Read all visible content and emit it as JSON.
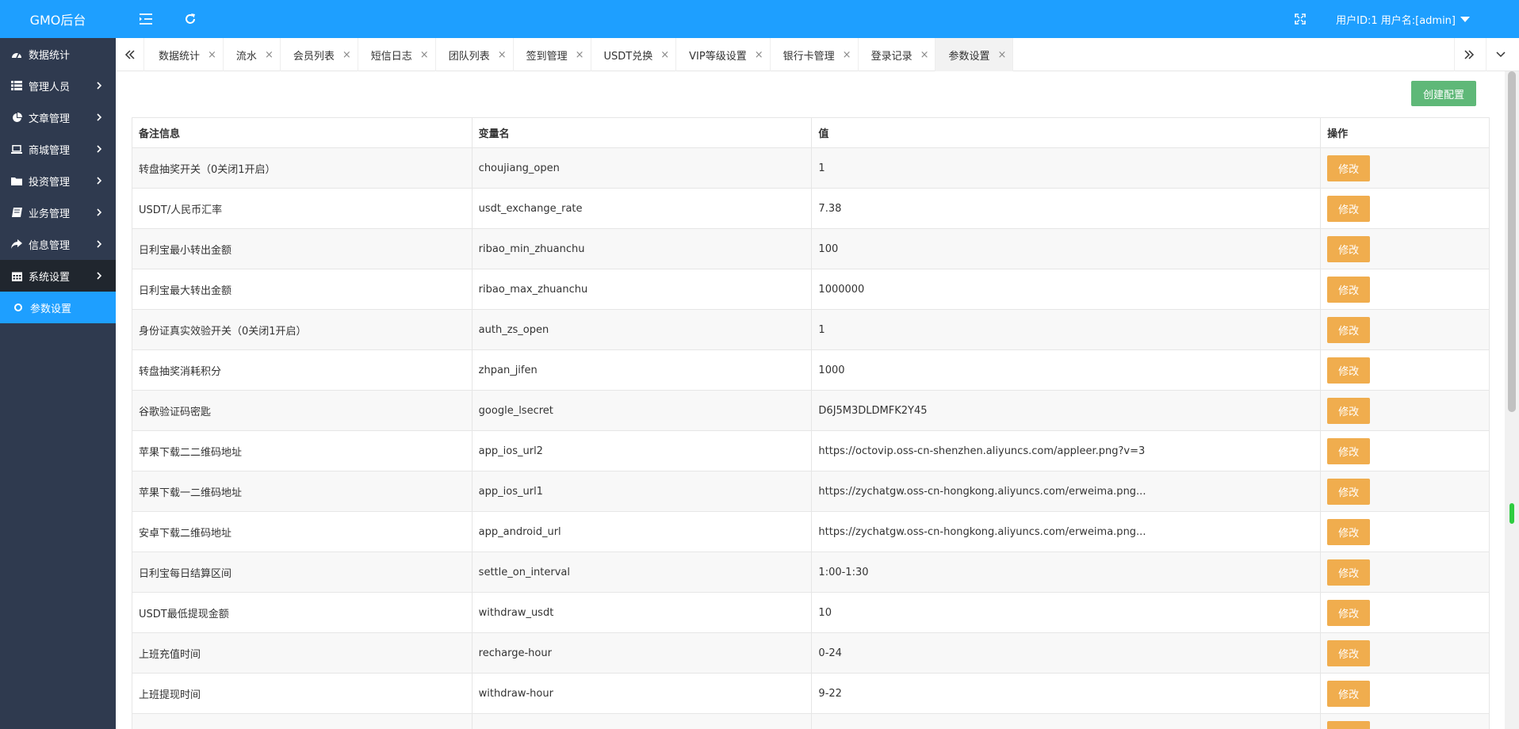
{
  "app": {
    "title": "GMO后台"
  },
  "header": {
    "user_label": "用户ID:1 用户名:[admin]"
  },
  "sidebar": {
    "items": [
      {
        "label": "数据统计",
        "icon": "dashboard-icon"
      },
      {
        "label": "管理人员",
        "icon": "grid-icon"
      },
      {
        "label": "文章管理",
        "icon": "pie-chart-icon"
      },
      {
        "label": "商城管理",
        "icon": "laptop-icon"
      },
      {
        "label": "投资管理",
        "icon": "folder-icon"
      },
      {
        "label": "业务管理",
        "icon": "book-icon"
      },
      {
        "label": "信息管理",
        "icon": "share-icon"
      },
      {
        "label": "系统设置",
        "icon": "calendar-icon"
      },
      {
        "label": "参数设置",
        "icon": "circle-icon"
      }
    ]
  },
  "tabs": [
    {
      "label": "数据统计"
    },
    {
      "label": "流水"
    },
    {
      "label": "会员列表"
    },
    {
      "label": "短信日志"
    },
    {
      "label": "团队列表"
    },
    {
      "label": "签到管理"
    },
    {
      "label": "USDT兑换"
    },
    {
      "label": "VIP等级设置"
    },
    {
      "label": "银行卡管理"
    },
    {
      "label": "登录记录"
    },
    {
      "label": "参数设置"
    }
  ],
  "tab_close": "×",
  "main": {
    "create_label": "创建配置",
    "columns": [
      "备注信息",
      "变量名",
      "值",
      "操作"
    ],
    "edit_label": "修改",
    "rows": [
      {
        "note": "转盘抽奖开关（0关闭1开启）",
        "name": "choujiang_open",
        "value": "1"
      },
      {
        "note": "USDT/人民币汇率",
        "name": "usdt_exchange_rate",
        "value": "7.38"
      },
      {
        "note": "日利宝最小转出金额",
        "name": "ribao_min_zhuanchu",
        "value": "100"
      },
      {
        "note": "日利宝最大转出金额",
        "name": "ribao_max_zhuanchu",
        "value": "1000000"
      },
      {
        "note": "身份证真实效验开关（0关闭1开启）",
        "name": "auth_zs_open",
        "value": "1"
      },
      {
        "note": "转盘抽奖消耗积分",
        "name": "zhpan_jifen",
        "value": "1000"
      },
      {
        "note": "谷歌验证码密匙",
        "name": "google_lsecret",
        "value": "D6J5M3DLDMFK2Y45"
      },
      {
        "note": "苹果下载二二维码地址",
        "name": "app_ios_url2",
        "value": "https://octovip.oss-cn-shenzhen.aliyuncs.com/appleer.png?v=3"
      },
      {
        "note": "苹果下载一二维码地址",
        "name": "app_ios_url1",
        "value": "https://zychatgw.oss-cn-hongkong.aliyuncs.com/erweima.png..."
      },
      {
        "note": "安卓下载二维码地址",
        "name": "app_android_url",
        "value": "https://zychatgw.oss-cn-hongkong.aliyuncs.com/erweima.png..."
      },
      {
        "note": "日利宝每日结算区间",
        "name": "settle_on_interval",
        "value": "1:00-1:30"
      },
      {
        "note": "USDT最低提现金额",
        "name": "withdraw_usdt",
        "value": "10"
      },
      {
        "note": "上班充值时间",
        "name": "recharge-hour",
        "value": "0-24"
      },
      {
        "note": "上班提现时间",
        "name": "withdraw-hour",
        "value": "9-22"
      },
      {
        "note": "",
        "name": "",
        "value": ""
      }
    ]
  }
}
